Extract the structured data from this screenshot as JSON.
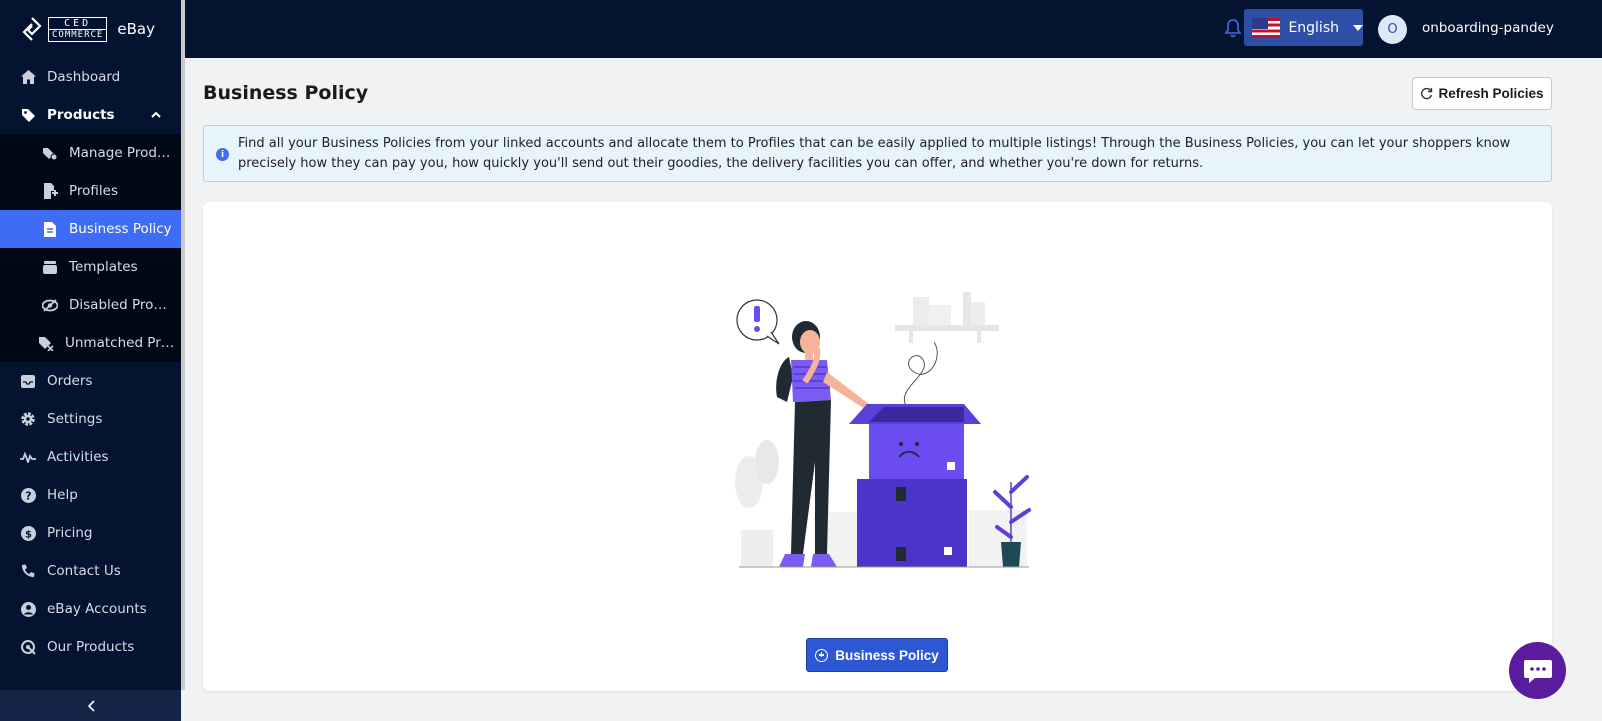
{
  "brand": {
    "ced_top": "CED",
    "ced_bottom": "COMMERCE",
    "product": "eBay"
  },
  "sidebar": {
    "items": [
      {
        "label": "Dashboard",
        "icon": "home-icon"
      },
      {
        "label": "Products",
        "icon": "tag-icon",
        "expanded": true
      },
      {
        "label": "Orders",
        "icon": "inbox-icon"
      },
      {
        "label": "Settings",
        "icon": "gear-icon"
      },
      {
        "label": "Activities",
        "icon": "activity-icon"
      },
      {
        "label": "Help",
        "icon": "question-icon"
      },
      {
        "label": "Pricing",
        "icon": "dollar-icon"
      },
      {
        "label": "Contact Us",
        "icon": "phone-icon"
      },
      {
        "label": "eBay Accounts",
        "icon": "user-circle-icon"
      },
      {
        "label": "Our Products",
        "icon": "products-icon"
      }
    ],
    "sub_items": [
      {
        "label": "Manage Prod…",
        "icon": "tags-gear-icon"
      },
      {
        "label": "Profiles",
        "icon": "profile-doc-icon"
      },
      {
        "label": "Business Policy",
        "icon": "document-icon",
        "active": true
      },
      {
        "label": "Templates",
        "icon": "template-icon"
      },
      {
        "label": "Disabled Pro…",
        "icon": "eye-slash-icon"
      },
      {
        "label": "Unmatched Pr…",
        "icon": "tag-x-icon"
      }
    ],
    "collapse_icon": "chevron-left-icon"
  },
  "topbar": {
    "language": "English",
    "avatar_initial": "O",
    "username": "onboarding-pandey"
  },
  "main": {
    "title": "Business Policy",
    "refresh_label": "Refresh Policies",
    "info_text": "Find all your Business Policies from your linked accounts and allocate them to Profiles that can be easily applied to multiple listings! Through the Business Policies, you can let your shoppers know precisely how they can pay you, how quickly you'll send out their goodies, the delivery facilities you can offer, and whether you're down for returns.",
    "info_icon_glyph": "i",
    "empty_action_label": "Business Policy"
  },
  "colors": {
    "sidebar_bg": "#041330",
    "active_item": "#3f6cf7",
    "primary_button": "#2e58d3",
    "info_bg": "#e7f4fc",
    "illustration_purple": "#6a4cf0",
    "chat_fab": "#5b1b9e"
  }
}
